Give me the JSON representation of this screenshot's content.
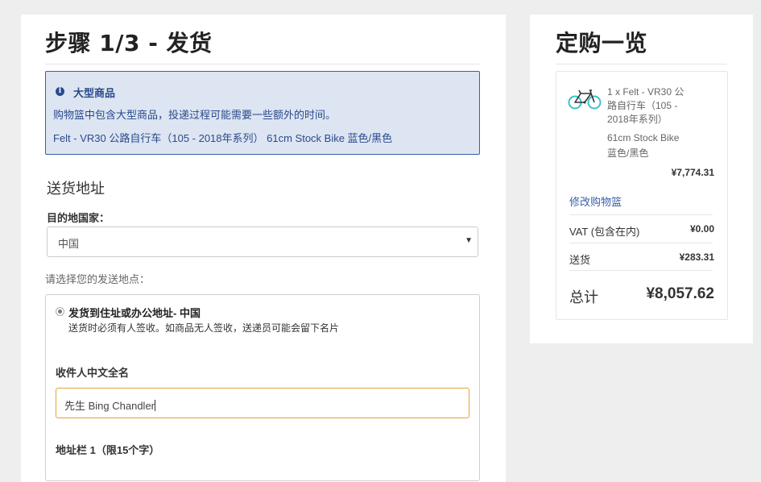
{
  "checkout": {
    "heading": "步骤 1/3 - 发货",
    "info_box": {
      "title": "大型商品",
      "message": "购物篮中包含大型商品，投递过程可能需要一些额外的时间。",
      "item": "Felt - VR30 公路自行车（105 - 2018年系列）   61cm Stock Bike 蓝色/黑色"
    },
    "address_section": {
      "title": "送货地址",
      "country_label": "目的地国家：",
      "country_value": "中国",
      "ship_prompt": "请选择您的发送地点：",
      "option": {
        "title": "发货到住址或办公地址- 中国",
        "desc": "送货时必须有人签收。如商品无人签收，送递员可能会留下名片"
      },
      "recipient_label": "收件人中文全名",
      "recipient_value": "先生 Bing Chandler",
      "address_line_label": "地址栏 1（限15个字）"
    }
  },
  "summary": {
    "heading": "定购一览",
    "item": {
      "line1": "1 x Felt - VR30 公",
      "line2": "路自行车（105 -",
      "line3": "2018年系列）",
      "variant1": "61cm Stock Bike",
      "variant2": "蓝色/黑色",
      "price": "¥7,774.31"
    },
    "edit_basket": "修改购物篮",
    "vat_label": "VAT (包含在内)",
    "vat_value": "¥0.00",
    "shipping_label": "送货",
    "shipping_value": "¥283.31",
    "total_label": "总计",
    "total_value": "¥8,057.62"
  },
  "icons": {
    "info": "info-circle-icon",
    "bike": "bicycle-icon",
    "caret": "caret-down-icon"
  },
  "colors": {
    "accent_blue": "#3b5ea8",
    "info_bg": "#dde5f3",
    "focus_orange": "#e4a13a",
    "bike_teal": "#3ec1c9"
  }
}
